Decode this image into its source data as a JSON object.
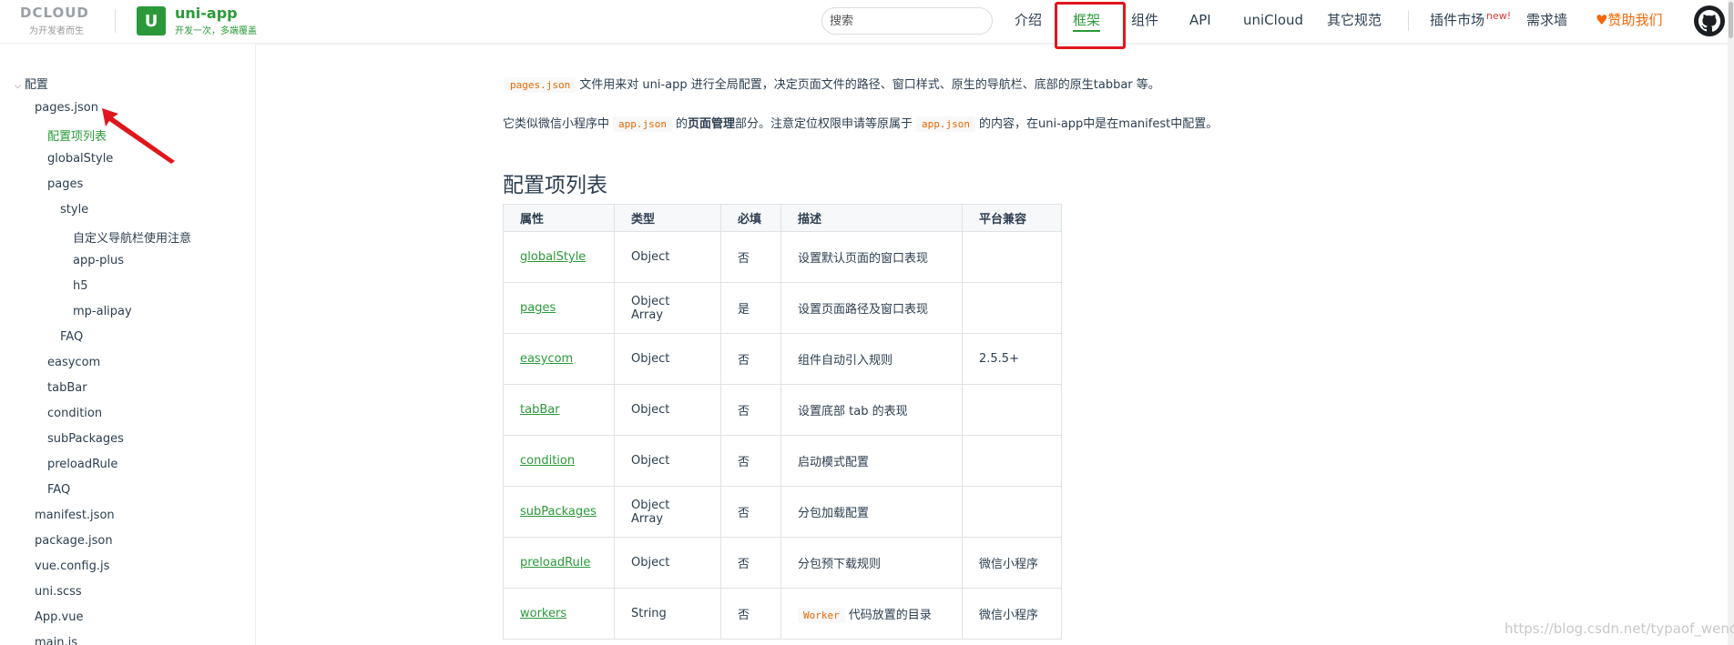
{
  "header": {
    "dcloud_logo": "DCLOUD",
    "dcloud_slogan": "为开发者而生",
    "uni_badge": "U",
    "uni_title": "uni-app",
    "uni_slogan": "开发一次，多端覆盖",
    "search_placeholder": "搜索",
    "nav": [
      {
        "label": "介绍"
      },
      {
        "label": "框架"
      },
      {
        "label": "组件"
      },
      {
        "label": "API"
      },
      {
        "label": "uniCloud"
      },
      {
        "label": "其它规范"
      },
      {
        "label": "插件市场",
        "badge": "new!"
      },
      {
        "label": "需求墙"
      },
      {
        "label": "赞助我们",
        "prefix": "♥"
      }
    ]
  },
  "sidebar": {
    "items": [
      {
        "label": "配置",
        "caret": "⌵"
      },
      {
        "label": "pages.json"
      },
      {
        "label": "配置项列表"
      },
      {
        "label": "globalStyle"
      },
      {
        "label": "pages"
      },
      {
        "label": "style"
      },
      {
        "label": "自定义导航栏使用注意"
      },
      {
        "label": "app-plus"
      },
      {
        "label": "h5"
      },
      {
        "label": "mp-alipay"
      },
      {
        "label": "FAQ"
      },
      {
        "label": "easycom"
      },
      {
        "label": "tabBar"
      },
      {
        "label": "condition"
      },
      {
        "label": "subPackages"
      },
      {
        "label": "preloadRule"
      },
      {
        "label": "FAQ"
      },
      {
        "label": "manifest.json"
      },
      {
        "label": "package.json"
      },
      {
        "label": "vue.config.js"
      },
      {
        "label": "uni.scss"
      },
      {
        "label": "App.vue"
      },
      {
        "label": "main.js"
      }
    ]
  },
  "content": {
    "p1": {
      "code": "pages.json",
      "text": "文件用来对 uni-app 进行全局配置，决定页面文件的路径、窗口样式、原生的导航栏、底部的原生tabbar 等。"
    },
    "p2": {
      "pre": "它类似微信小程序中",
      "code1": "app.json",
      "mid1": "的",
      "bold": "页面管理",
      "mid2": "部分。注意定位权限申请等原属于",
      "code2": "app.json",
      "post": "的内容，在uni-app中是在manifest中配置。"
    },
    "section_title": "配置项列表",
    "table": {
      "headers": [
        "属性",
        "类型",
        "必填",
        "描述",
        "平台兼容"
      ],
      "rows": [
        {
          "prop": "globalStyle",
          "type": "Object",
          "required": "否",
          "desc": "设置默认页面的窗口表现",
          "platform": ""
        },
        {
          "prop": "pages",
          "type": "Object Array",
          "required": "是",
          "desc": "设置页面路径及窗口表现",
          "platform": ""
        },
        {
          "prop": "easycom",
          "type": "Object",
          "required": "否",
          "desc": "组件自动引入规则",
          "platform": "2.5.5+"
        },
        {
          "prop": "tabBar",
          "type": "Object",
          "required": "否",
          "desc": "设置底部 tab 的表现",
          "platform": ""
        },
        {
          "prop": "condition",
          "type": "Object",
          "required": "否",
          "desc": "启动模式配置",
          "platform": ""
        },
        {
          "prop": "subPackages",
          "type": "Object Array",
          "required": "否",
          "desc": "分包加载配置",
          "platform": ""
        },
        {
          "prop": "preloadRule",
          "type": "Object",
          "required": "否",
          "desc": "分包预下载规则",
          "platform": "微信小程序"
        },
        {
          "prop": "workers",
          "type": "String",
          "required": "否",
          "desc_code": "Worker",
          "desc": "代码放置的目录",
          "platform": "微信小程序"
        }
      ]
    }
  },
  "watermark": "https://blog.csdn.net/typaof_wendu",
  "colors": {
    "accent": "#2b9939",
    "highlight_box": "#e0161d",
    "code": "#e96900",
    "sponsor": "#f76707"
  }
}
